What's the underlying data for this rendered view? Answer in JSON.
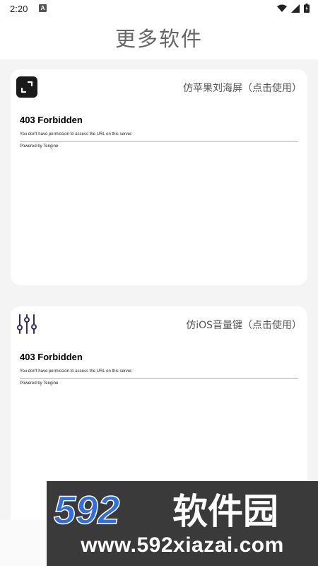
{
  "status": {
    "time": "2:20",
    "badge": "A"
  },
  "header": {
    "title": "更多软件"
  },
  "cards": [
    {
      "label": "仿苹果刘海屏（点击使用）",
      "icon": "expand-icon",
      "error": {
        "title": "403 Forbidden",
        "message": "You don't have permission to access the URL on this server.",
        "footer": "Powered by Tengine"
      }
    },
    {
      "label": "仿iOS音量键（点击使用）",
      "icon": "sliders-icon",
      "error": {
        "title": "403 Forbidden",
        "message": "You don't have permission to access the URL on this server.",
        "footer": "Powered by Tengine"
      }
    }
  ],
  "watermark": {
    "brand_number": "592",
    "brand_text": "软件园",
    "url": "www.592xiazai.com"
  },
  "colors": {
    "accent_blue": "#2f6fe0",
    "icon_dark": "#1a1a1a",
    "icon_purple": "#3a2a5a"
  }
}
